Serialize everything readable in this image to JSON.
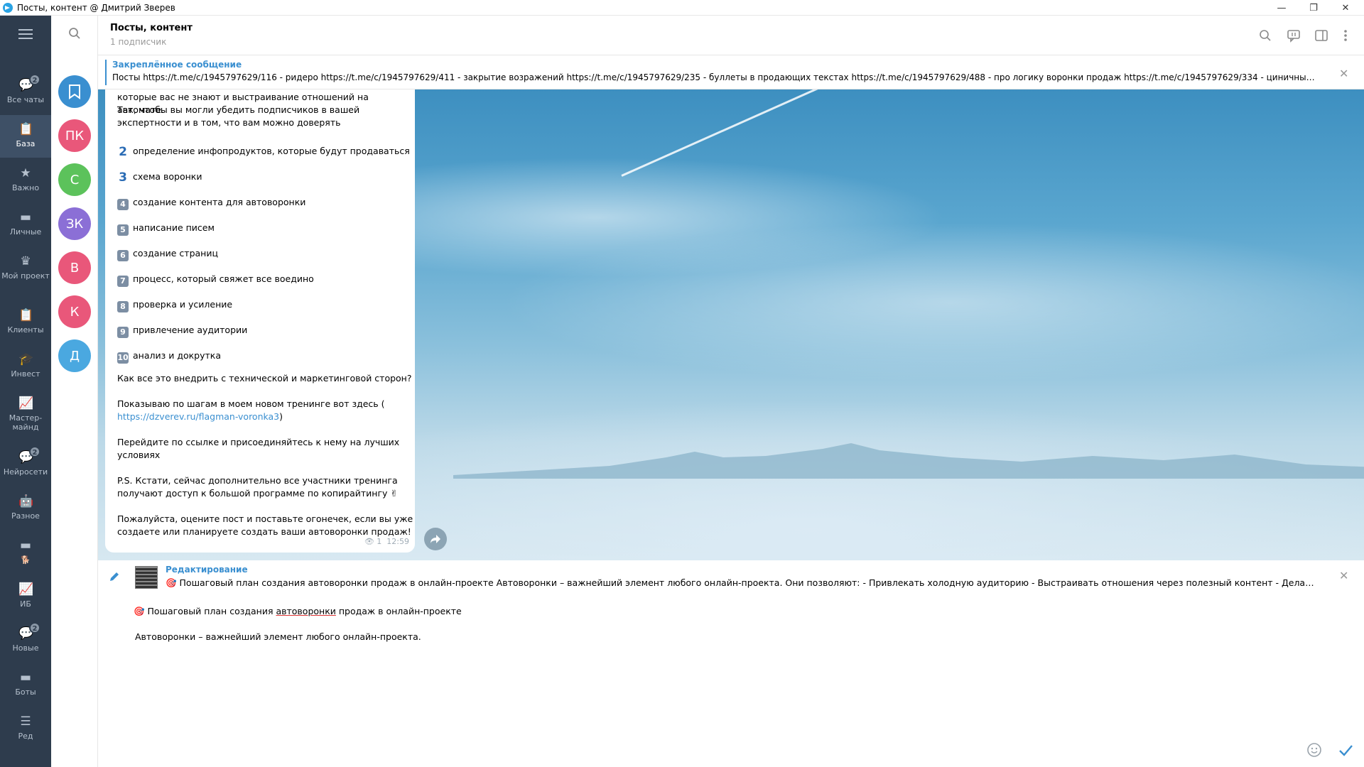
{
  "window": {
    "title": "Посты, контент @ Дмитрий Зверев",
    "minimize": "—",
    "restore": "❐",
    "close": "✕"
  },
  "folders": [
    {
      "label": "Все чаты",
      "icon": "chats-icon",
      "badge": "2"
    },
    {
      "label": "База",
      "icon": "clipboard-icon",
      "active": true
    },
    {
      "label": "Важно",
      "icon": "star-icon"
    },
    {
      "label": "Личные",
      "icon": "folder-icon"
    },
    {
      "label": "Мой проект",
      "icon": "crown-icon"
    },
    {
      "label": "Клиенты",
      "icon": "clipboard-icon"
    },
    {
      "label": "Инвест",
      "icon": "graduation-cap-icon"
    },
    {
      "label": "Мастер-майнд",
      "icon": "chart-icon"
    },
    {
      "label": "Нейросети",
      "icon": "chat-bubble-icon",
      "badge": "2"
    },
    {
      "label": "Разное",
      "icon": "robot-icon"
    },
    {
      "label": "🐕",
      "icon": "folder-icon"
    },
    {
      "label": "ИБ",
      "icon": "chart-icon"
    },
    {
      "label": "Новые",
      "icon": "chat-bubble-icon",
      "badge": "2"
    },
    {
      "label": "Боты",
      "icon": "folder-icon"
    },
    {
      "label": "Ред",
      "icon": "sliders-icon"
    }
  ],
  "chat_avatars": [
    {
      "letters": "",
      "color": "#3a8fd0",
      "icon": "bookmark-icon"
    },
    {
      "letters": "ПК",
      "color": "#e9577a"
    },
    {
      "letters": "С",
      "color": "#5cc25b"
    },
    {
      "letters": "ЗК",
      "color": "#8b6fd6"
    },
    {
      "letters": "В",
      "color": "#e9577a"
    },
    {
      "letters": "К",
      "color": "#e9577a"
    },
    {
      "letters": "Д",
      "color": "#4aa8e0"
    }
  ],
  "header": {
    "title": "Посты, контент",
    "subtitle": "1 подписчик"
  },
  "pinned": {
    "title": "Закреплённое сообщение",
    "text": "Посты  https://t.me/c/1945797629/116 - ридеро https://t.me/c/1945797629/411 - закрытие возражений https://t.me/c/1945797629/235 - буллеты в продающих текстах https://t.me/c/1945797629/488 - про логику воронки продаж https://t.me/c/1945797629/334 - циничный копир..."
  },
  "message": {
    "intro_1": "которые вас не знают и выстраивание отношений на автомате.",
    "intro_2": "Так, чтобы вы могли убедить подписчиков в вашей",
    "intro_3": "экспертности и в том, что вам можно доверять",
    "items": [
      {
        "n": "2",
        "text": "определение инфопродуктов, которые будут продаваться"
      },
      {
        "n": "3",
        "text": "схема воронки"
      },
      {
        "n": "4",
        "text": "создание контента для автоворонки"
      },
      {
        "n": "5",
        "text": "написание писем"
      },
      {
        "n": "6",
        "text": "создание страниц"
      },
      {
        "n": "7",
        "text": "процесс, который свяжет все воедино"
      },
      {
        "n": "8",
        "text": "проверка и усиление"
      },
      {
        "n": "9",
        "text": "привлечение аудитории"
      },
      {
        "n": "10",
        "text": "анализ и докрутка"
      }
    ],
    "q": "Как все это внедрить с технической и маркетинговой сторон?",
    "show_1": "Показываю по шагам в моем новом тренинге вот здесь (",
    "link": "https://dzverev.ru/flagman-voronka3",
    "show_close": ")",
    "go_1": "Перейдите по ссылке и присоединяйтесь к нему на лучших",
    "go_2": "условиях",
    "ps_1": "P.S. Кстати, сейчас дополнительно все участники тренинга",
    "ps_2": "получают доступ к большой программе по копирайтингу ✌",
    "end_1": "Пожалуйста, оцените пост и поставьте огонечек, если вы уже",
    "end_2": "создаете или планируете создать ваши автоворонки продаж!",
    "views": "1",
    "time": "12:59"
  },
  "edit": {
    "title": "Редактирование",
    "preview": "🎯 Пошаговый план создания автоворонки продаж в онлайн-проекте  Автоворонки – важнейший элемент любого онлайн-проекта.  Они позволяют: - Привлекать холодную аудиторию - Выстраивать отношения через полезный контент - Делать платные пре...",
    "line1_a": "🎯 Пошаговый план создания ",
    "line1_u": "автоворонки",
    "line1_b": " продаж в онлайн-проекте",
    "line2": "Автоворонки – важнейший элемент любого онлайн-проекта."
  },
  "colors": {
    "accent": "#3a8fd0",
    "sidebar": "#2e3c4d",
    "sidebar_active": "#3e5066"
  }
}
